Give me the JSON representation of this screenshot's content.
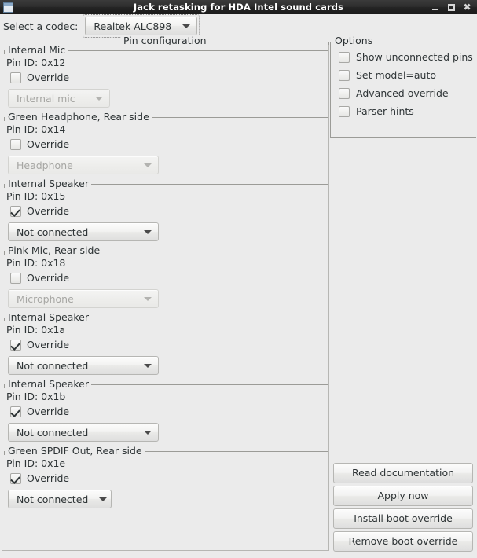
{
  "window": {
    "title": "Jack retasking for HDA Intel sound cards",
    "icon": "window-icon",
    "controls": [
      {
        "name": "minimize-button",
        "glyph": "minimize-icon"
      },
      {
        "name": "maximize-button",
        "glyph": "maximize-icon"
      },
      {
        "name": "close-button",
        "glyph": "close-icon"
      }
    ]
  },
  "codec": {
    "label": "Select a codec:",
    "selected": "Realtek ALC898"
  },
  "pin_configuration": {
    "legend": "Pin configuration",
    "override_label": "Override",
    "sections": [
      {
        "name": "Internal Mic",
        "pin_id_label": "Pin ID: 0x12",
        "override_checked": false,
        "combo_value": "Internal mic",
        "combo_enabled": false,
        "combo_width": 130
      },
      {
        "name": "Green Headphone, Rear side",
        "pin_id_label": "Pin ID: 0x14",
        "override_checked": false,
        "combo_value": "Headphone",
        "combo_enabled": false,
        "combo_width": 192
      },
      {
        "name": "Internal Speaker",
        "pin_id_label": "Pin ID: 0x15",
        "override_checked": true,
        "combo_value": "Not connected",
        "combo_enabled": true,
        "combo_width": 192
      },
      {
        "name": "Pink Mic, Rear side",
        "pin_id_label": "Pin ID: 0x18",
        "override_checked": false,
        "combo_value": "Microphone",
        "combo_enabled": false,
        "combo_width": 192
      },
      {
        "name": "Internal Speaker",
        "pin_id_label": "Pin ID: 0x1a",
        "override_checked": true,
        "combo_value": "Not connected",
        "combo_enabled": true,
        "combo_width": 192
      },
      {
        "name": "Internal Speaker",
        "pin_id_label": "Pin ID: 0x1b",
        "override_checked": true,
        "combo_value": "Not connected",
        "combo_enabled": true,
        "combo_width": 192
      },
      {
        "name": "Green SPDIF Out, Rear side",
        "pin_id_label": "Pin ID: 0x1e",
        "override_checked": true,
        "combo_value": "Not connected",
        "combo_enabled": true,
        "combo_width": 132
      }
    ]
  },
  "options": {
    "legend": "Options",
    "items": [
      {
        "label": "Show unconnected pins",
        "checked": false
      },
      {
        "label": "Set model=auto",
        "checked": false
      },
      {
        "label": "Advanced override",
        "checked": false
      },
      {
        "label": "Parser hints",
        "checked": false
      }
    ]
  },
  "actions": [
    {
      "label": "Read documentation",
      "name": "read-documentation-button"
    },
    {
      "label": "Apply now",
      "name": "apply-now-button"
    },
    {
      "label": "Install boot override",
      "name": "install-boot-override-button"
    },
    {
      "label": "Remove boot override",
      "name": "remove-boot-override-button"
    }
  ],
  "colors": {
    "window_bg": "#ebebeb",
    "titlebar": "#2b2b2b",
    "text": "#2e3436",
    "disabled_text": "#a6a6a3",
    "border": "#b6b6b3"
  }
}
